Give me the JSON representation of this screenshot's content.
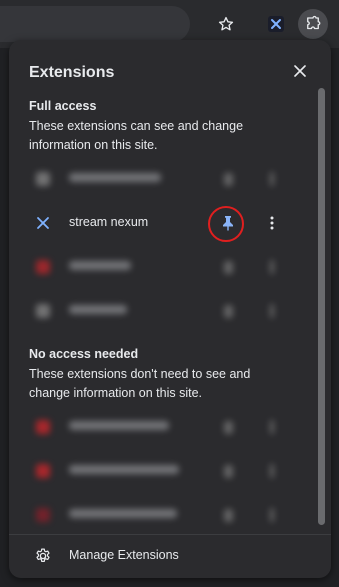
{
  "panel": {
    "title": "Extensions"
  },
  "full_access": {
    "heading": "Full access",
    "description": "These extensions can see and change information on this site."
  },
  "full_access_items": [
    {
      "name": "",
      "blurred": true,
      "icon_color": "#8a8a8a"
    },
    {
      "name": "stream nexum",
      "blurred": false,
      "icon": "crossed-arrows-icon",
      "pinned": true
    },
    {
      "name": "",
      "blurred": true,
      "icon_color": "#c0262b"
    },
    {
      "name": "",
      "blurred": true,
      "icon_color": "#8a8a8a"
    }
  ],
  "no_access": {
    "heading": "No access needed",
    "description": "These extensions don't need to see and change information on this site."
  },
  "no_access_items": [
    {
      "name": "",
      "blurred": true,
      "icon_color": "#d0262b"
    },
    {
      "name": "",
      "blurred": true,
      "icon_color": "#d0262b"
    },
    {
      "name": "",
      "blurred": true,
      "icon_color": "#8a1f2a"
    }
  ],
  "footer": {
    "manage_label": "Manage Extensions"
  },
  "colors": {
    "pin_active": "#8ab4f8",
    "highlight_ring": "#e01f1f",
    "panel_bg": "#2b2b2e"
  }
}
